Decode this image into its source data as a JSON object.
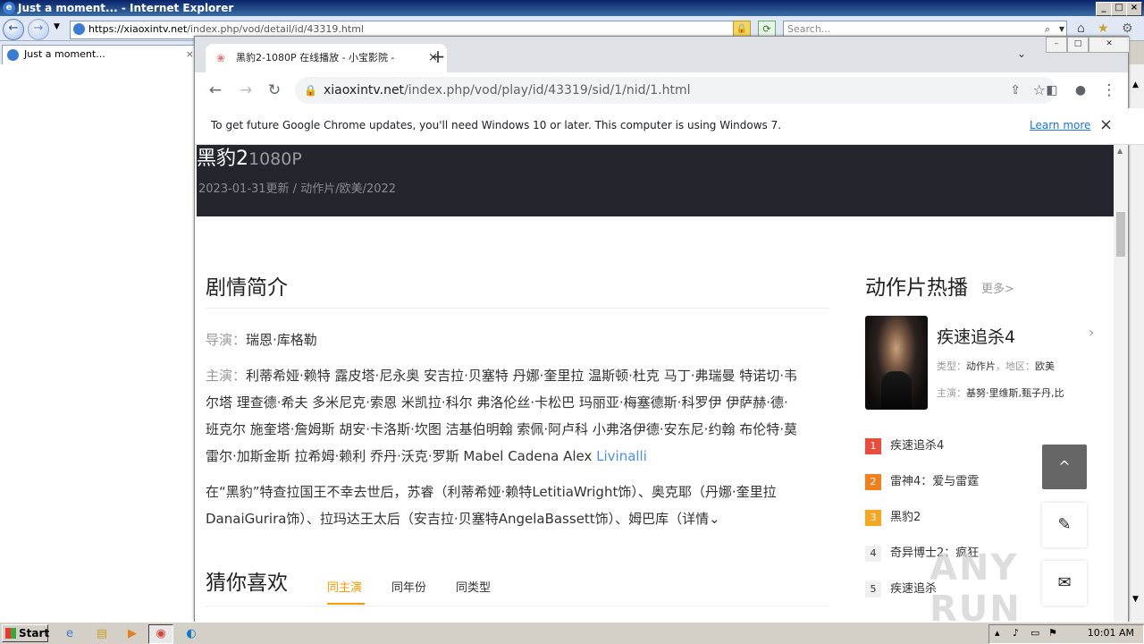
{
  "ie": {
    "title": "Just a moment... - Internet Explorer",
    "address": {
      "prefix": "https://xiaoxintv.net",
      "rest": "/index.php/vod/detail/id/43319.html"
    },
    "search_placeholder": "Search...",
    "tab_label": "Just a moment...",
    "tab_close": "×"
  },
  "chrome": {
    "tab_title": "黑豹2-1080P 在线播放 - 小宝影院 -",
    "tab_close": "×",
    "new_tab": "+",
    "tab_menu": "⌄",
    "url_host": "xiaoxintv.net",
    "url_path": "/index.php/vod/play/id/43319/sid/1/nid/1.html",
    "infobar_text": "To get future Google Chrome updates, you'll need Windows 10 or later. This computer is using Windows 7.",
    "infobar_link": "Learn more",
    "infobar_close": "×"
  },
  "page": {
    "title": "黑豹2",
    "quality": "1080P",
    "meta": "2023-01-31更新 / 动作片/欧美/2022",
    "plot_heading": "剧情简介",
    "director_label": "导演：",
    "director": "瑞恩·库格勒",
    "cast_label": "主演：",
    "cast_line1": "利蒂希娅·赖特 露皮塔·尼永奥 安吉拉·贝塞特 丹娜·奎里拉 温斯顿·杜克 马丁·弗瑞曼 特诺切·韦",
    "cast_line2": "尔塔 理查德·希夫 多米尼克·索恩 米凯拉·科尔 弗洛伦丝·卡松巴 玛丽亚·梅塞德斯·科罗伊 伊萨赫·德·",
    "cast_line3": "班克尔 施奎塔·詹姆斯 胡安·卡洛斯·坎图 洁基伯明翰 索佩·阿卢科 小弗洛伊德·安东尼·约翰 布伦特·莫",
    "cast_line4": "雷尔·加斯金斯 拉希姆·赖利 乔丹·沃克·罗斯 Mabel Cadena Alex ",
    "cast_link": "Livinalli",
    "synopsis_line1": "在“黑豹”特查拉国王不幸去世后，苏睿（利蒂希娅·赖特LetitiaWright饰）、奥克耶（丹娜·奎里拉",
    "synopsis_line2": "DanaiGurira饰）、拉玛达王太后（安吉拉·贝塞特AngelaBassett饰）、姆巴库（详情⌄",
    "guess_heading": "猜你喜欢",
    "guess_tabs": [
      "同主演",
      "同年份",
      "同类型"
    ]
  },
  "sidebar": {
    "title": "动作片热播",
    "more": "更多>",
    "featured": {
      "name": "疾速追杀4",
      "type_label": "类型：",
      "type": "动作片",
      "region_label": "，地区：",
      "region": "欧美",
      "cast_label": "主演：",
      "cast": "基努·里维斯,甄子丹,比"
    },
    "ranks": [
      {
        "num": "1",
        "name": "疾速追杀4"
      },
      {
        "num": "2",
        "name": "雷神4：爱与雷霆"
      },
      {
        "num": "3",
        "name": "黑豹2"
      },
      {
        "num": "4",
        "name": "奇异博士2：疯狂"
      },
      {
        "num": "5",
        "name": "疾速追杀"
      }
    ]
  },
  "floating": {
    "to_top": "^",
    "brush": "✎",
    "chat": "✉"
  },
  "watermark": "ANY RUN",
  "taskbar": {
    "start": "Start",
    "clock": "10:01 AM"
  }
}
